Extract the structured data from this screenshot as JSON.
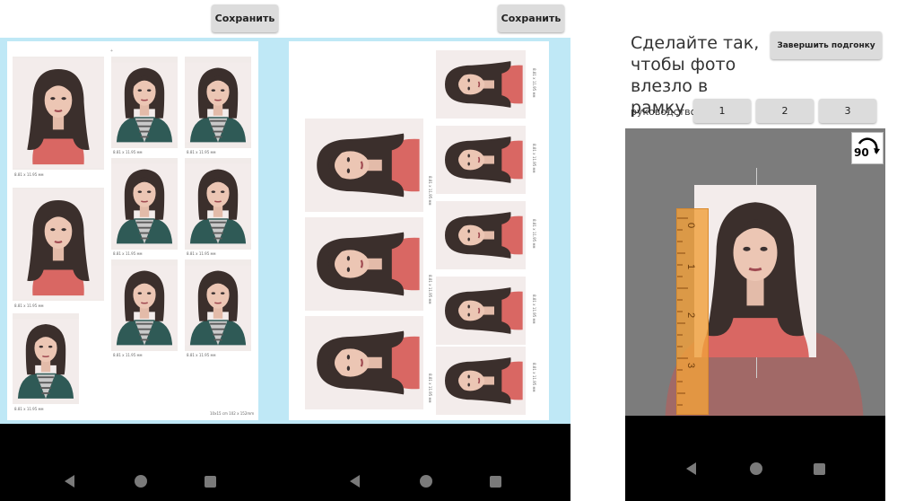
{
  "screen1": {
    "save_label": "Сохранить",
    "size_label": "8.81 x 11.95 мм",
    "paper_label": "10x15 cm 102 x 152mm",
    "mark": "+"
  },
  "screen2": {
    "save_label": "Сохранить",
    "size_label": "8.81 x 11.95 мм"
  },
  "screen3": {
    "instruction": "Сделайте так, чтобы фото влезло в рамку",
    "finish_label": "Завершить подгонку",
    "guide_label": "руководство",
    "guide_buttons": [
      "1",
      "2",
      "3"
    ],
    "rotate_label": "90",
    "ruler_ticks": [
      "0",
      "1",
      "2",
      "3"
    ]
  },
  "icons": [
    "back-icon",
    "home-icon",
    "recent-apps-icon",
    "rotate-icon",
    "ruler-icon"
  ],
  "colors": {
    "preview_bg": "#bfe8f6",
    "button_bg": "#dcdcdc",
    "ruler": "#f0a545",
    "nav_bar": "#000000"
  }
}
